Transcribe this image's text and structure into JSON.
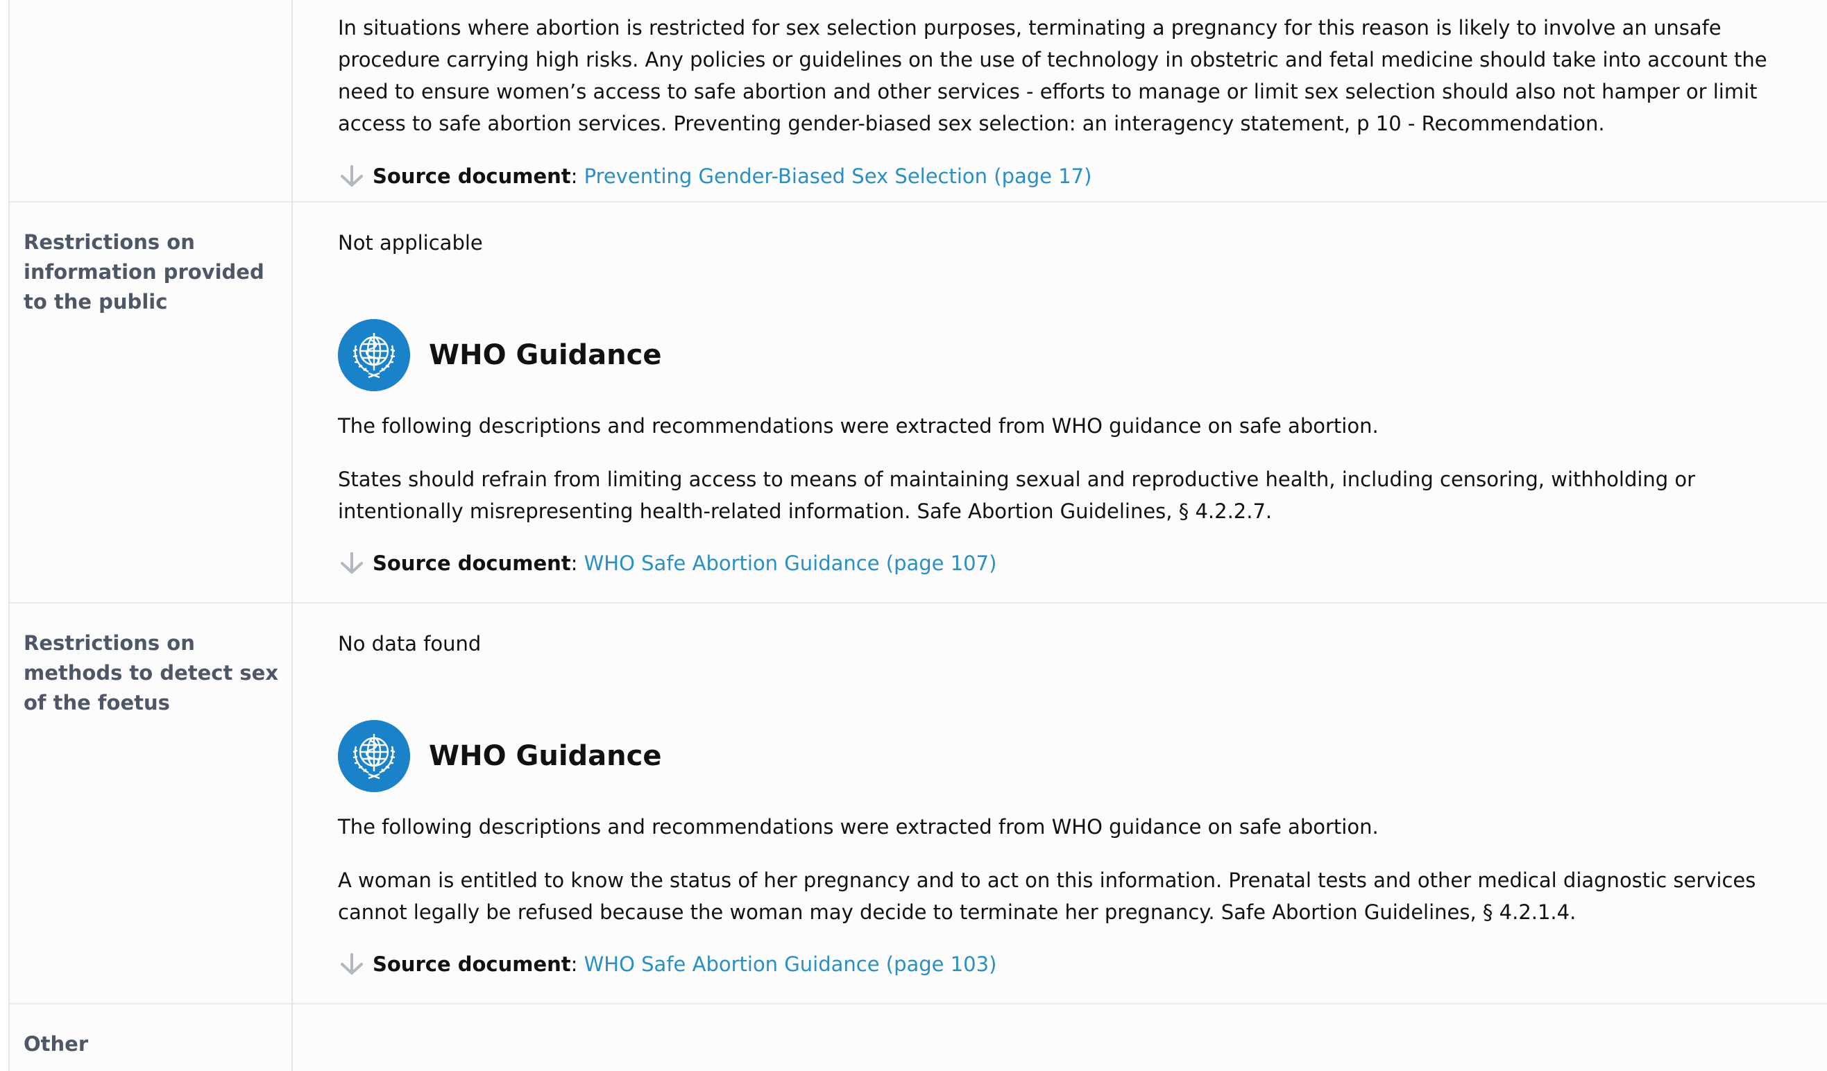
{
  "rows": [
    {
      "label": "",
      "paragraph": "In situations where abortion is restricted for sex selection purposes, terminating a pregnancy for this reason is likely to involve an unsafe procedure carrying high risks. Any policies or guidelines on the use of technology in obstetric and fetal medicine should take into account the need to ensure women’s access to safe abortion and other services - efforts to manage or limit sex selection should also not hamper or limit access to safe abortion services. Preventing gender-biased sex selection: an interagency statement, p 10 - Recommendation.",
      "source_label": "Source document",
      "source_link": "Preventing Gender-Biased Sex Selection (page 17)"
    },
    {
      "label": "Restrictions on information provided to the public",
      "status": "Not applicable",
      "guidance_title": "WHO Guidance",
      "guidance_intro": "The following descriptions and recommendations were extracted from WHO guidance on safe abortion.",
      "paragraph": "States should refrain from limiting access to means of maintaining sexual and reproductive health, including censoring, withholding or intentionally misrepresenting health-related information. Safe Abortion Guidelines, § 4.2.2.7.",
      "source_label": "Source document",
      "source_link": "WHO Safe Abortion Guidance (page 107)"
    },
    {
      "label": "Restrictions on methods to detect sex of the foetus",
      "status": "No data found",
      "guidance_title": "WHO Guidance",
      "guidance_intro": "The following descriptions and recommendations were extracted from WHO guidance on safe abortion.",
      "paragraph": "A woman is entitled to know the status of her pregnancy and to act on this information. Prenatal tests and other medical diagnostic services cannot legally be refused because the woman may decide to terminate her pregnancy. Safe Abortion Guidelines, § 4.2.1.4.",
      "source_label": "Source document",
      "source_link": "WHO Safe Abortion Guidance (page 103)"
    },
    {
      "label": "Other"
    }
  ],
  "icons": {
    "who_logo": "who-emblem-icon",
    "source_arrow": "arrow-down-icon"
  },
  "colors": {
    "link": "#2a8fc6",
    "who_blue": "#1a82c8",
    "label_gray": "#4f5665"
  }
}
